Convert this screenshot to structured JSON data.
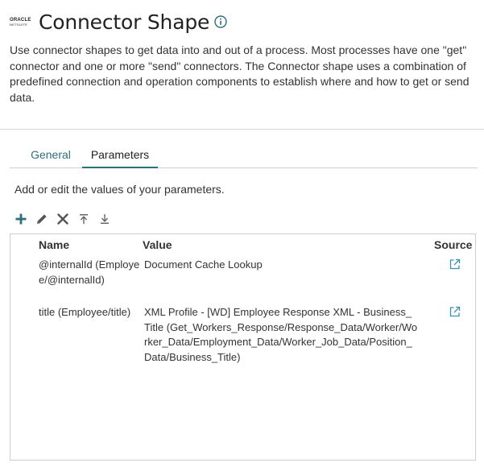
{
  "header": {
    "logo_top": "ORACLE",
    "logo_bottom": "NETSUITE",
    "title": "Connector Shape"
  },
  "description": "Use connector shapes to get data into and out of a process. Most processes have one \"get\" connector and one or more \"send\" connectors. The Connector shape uses a combination of predefined connection and operation components to establish where and how to get or send data.",
  "tabs": [
    {
      "label": "General",
      "active": false
    },
    {
      "label": "Parameters",
      "active": true
    }
  ],
  "hint": "Add or edit the values of your parameters.",
  "toolbar": {
    "icons": [
      "add-icon",
      "edit-icon",
      "delete-icon",
      "move-to-top-icon",
      "move-to-bottom-icon"
    ],
    "accent": "#2b6f7d"
  },
  "table": {
    "headers": {
      "name": "Name",
      "value": "Value",
      "source": "Source"
    },
    "rows": [
      {
        "name": "@internalId (Employee/@internalId)",
        "value": "Document Cache Lookup",
        "source_icon": "open-external-icon"
      },
      {
        "name": "title (Employee/title)",
        "value": "XML Profile - [WD] Employee Response XML - Business_Title (Get_Workers_Response/Response_Data/Worker/Worker_Data/Employment_Data/Worker_Job_Data/Position_Data/Business_Title)",
        "source_icon": "open-external-icon"
      }
    ]
  }
}
